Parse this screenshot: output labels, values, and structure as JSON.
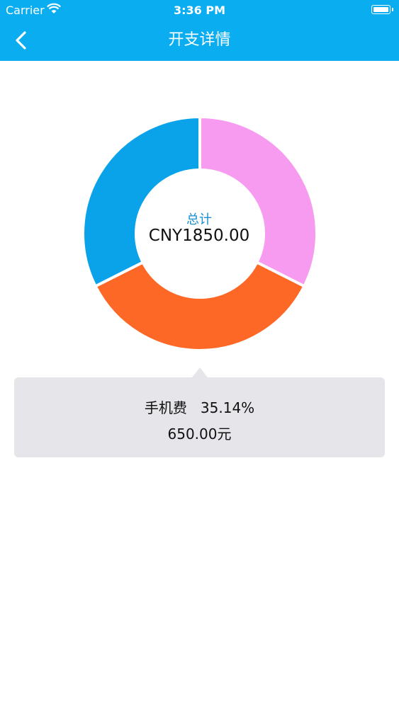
{
  "status_bar": {
    "carrier": "Carrier",
    "time": "3:36 PM"
  },
  "nav": {
    "title": "开支详情",
    "back_icon": "chevron-left-icon"
  },
  "chart_data": {
    "type": "pie",
    "center_label": "总计",
    "center_value": "CNY1850.00",
    "total": 1850.0,
    "slices": [
      {
        "color": "#f79bf0",
        "percent": 32.43
      },
      {
        "color": "#fd6826",
        "percent": 35.14
      },
      {
        "color": "#0aa3ea",
        "percent": 32.43
      }
    ]
  },
  "tooltip": {
    "category": "手机费",
    "percent": "35.14%",
    "amount": "650.00元"
  },
  "colors": {
    "header": "#0aaef0",
    "tooltip_bg": "#e6e5ea"
  }
}
